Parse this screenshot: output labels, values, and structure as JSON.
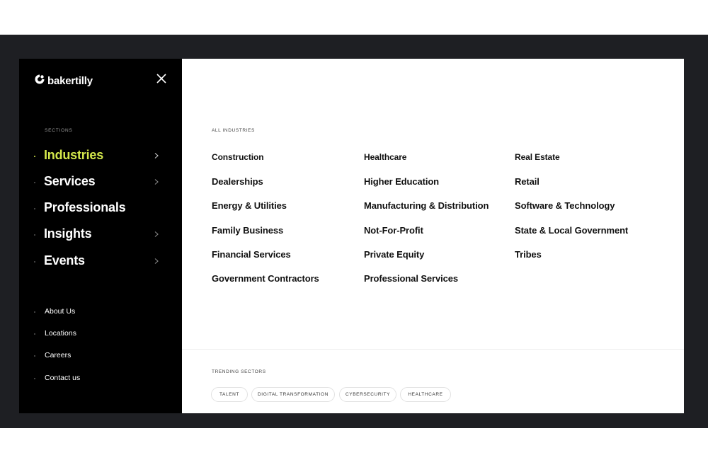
{
  "brand": {
    "name": "bakertilly",
    "accent_color": "#d4e84b"
  },
  "sidebar": {
    "close_icon": "close-icon",
    "sections_label": "SECTIONS",
    "main_nav": [
      {
        "label": "Industries",
        "active": true,
        "has_submenu": true
      },
      {
        "label": "Services",
        "active": false,
        "has_submenu": true
      },
      {
        "label": "Professionals",
        "active": false,
        "has_submenu": false
      },
      {
        "label": "Insights",
        "active": false,
        "has_submenu": true
      },
      {
        "label": "Events",
        "active": false,
        "has_submenu": true
      }
    ],
    "secondary_nav": [
      {
        "label": "About Us"
      },
      {
        "label": "Locations"
      },
      {
        "label": "Careers"
      },
      {
        "label": "Contact us"
      }
    ]
  },
  "panel": {
    "all_label": "ALL INDUSTRIES",
    "columns": [
      [
        "Construction",
        "Dealerships",
        "Energy & Utilities",
        "Family Business",
        "Financial Services",
        "Government Contractors"
      ],
      [
        "Healthcare",
        "Higher Education",
        "Manufacturing & Distribution",
        "Not-For-Profit",
        "Private Equity",
        "Professional Services"
      ],
      [
        "Real Estate",
        "Retail",
        "Software & Technology",
        "State & Local Government",
        "Tribes"
      ]
    ],
    "trending_label": "TRENDING SECTORS",
    "trending": [
      {
        "label": "TALENT"
      },
      {
        "label": "DIGITAL TRANSFORMATION"
      },
      {
        "label": "CYBERSECURITY"
      },
      {
        "label": "HEALTHCARE"
      }
    ]
  }
}
